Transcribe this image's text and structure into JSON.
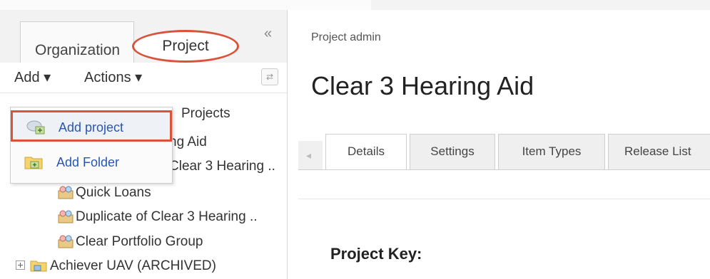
{
  "left_panel": {
    "tabs": {
      "organization": "Organization",
      "project": "Project"
    },
    "toolbar": {
      "add_label": "Add ▾",
      "actions_label": "Actions ▾"
    },
    "tree": {
      "projects_root": "Projects",
      "item_1": "ng Aid",
      "item_2": "Clear 3 Hearing ..",
      "item_3": "Quick Loans",
      "item_4": "Duplicate of Clear 3 Hearing ..",
      "item_5": "Clear Portfolio Group",
      "item_6": "Achiever UAV (ARCHIVED)"
    },
    "add_menu": {
      "add_project": "Add project",
      "add_folder": "Add Folder"
    }
  },
  "main": {
    "breadcrumb": "Project admin",
    "title": "Clear 3 Hearing Aid",
    "tabs": [
      "Details",
      "Settings",
      "Item Types",
      "Release List"
    ],
    "project_key_label": "Project Key:"
  },
  "colors": {
    "highlight": "#d9533a",
    "link": "#2a55b0"
  }
}
